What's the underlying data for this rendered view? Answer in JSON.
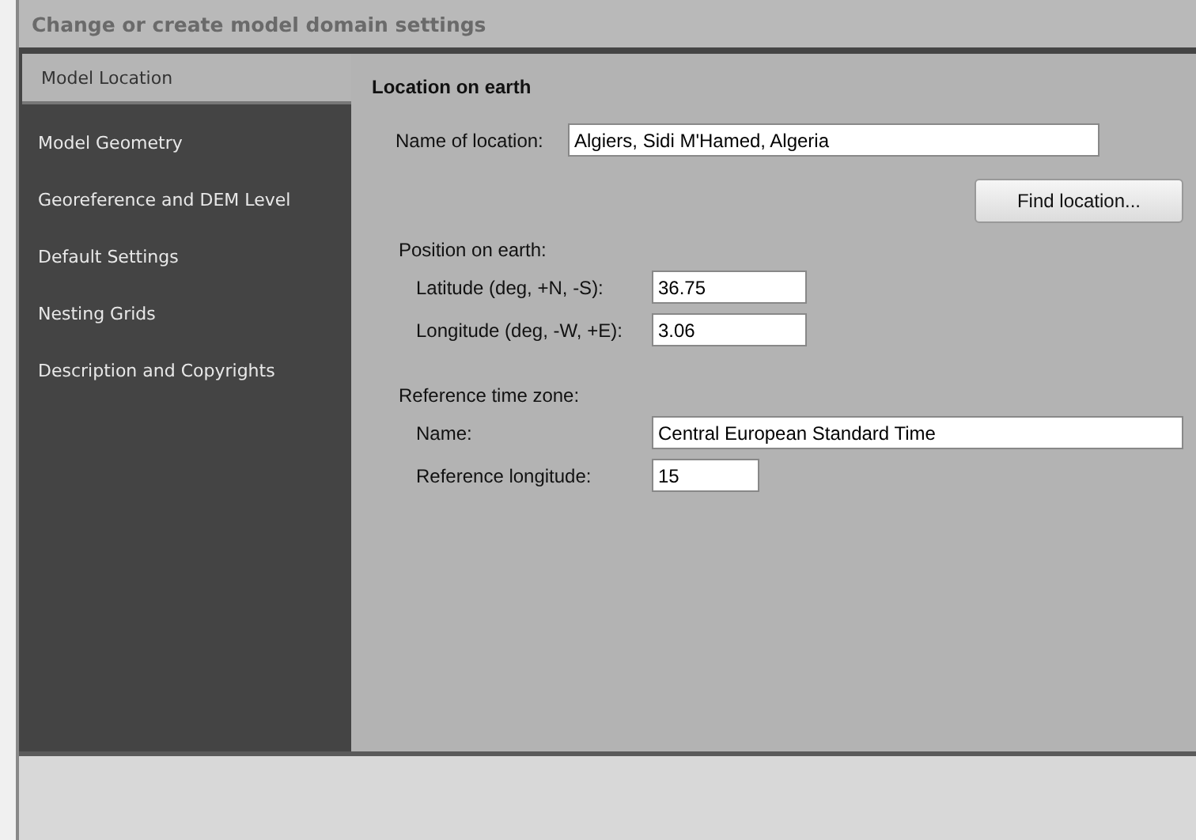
{
  "window": {
    "title": "Change or create model domain settings"
  },
  "sidebar": {
    "items": [
      {
        "label": "Model Location",
        "selected": true
      },
      {
        "label": "Model Geometry",
        "selected": false
      },
      {
        "label": "Georeference and DEM Level",
        "selected": false
      },
      {
        "label": "Default Settings",
        "selected": false
      },
      {
        "label": "Nesting Grids",
        "selected": false
      },
      {
        "label": "Description and Copyrights",
        "selected": false
      }
    ]
  },
  "content": {
    "heading": "Location on earth",
    "location_name": {
      "label": "Name of location:",
      "value": "Algiers, Sidi M'Hamed, Algeria"
    },
    "find_button": "Find location...",
    "position": {
      "label": "Position on earth:",
      "fields": [
        {
          "label": "Latitude (deg, +N, -S):",
          "value": "36.75"
        },
        {
          "label": "Longitude (deg, -W, +E):",
          "value": "3.06"
        }
      ]
    },
    "time_zone": {
      "label": "Reference time zone:",
      "fields": [
        {
          "label": "Name:",
          "value": "Central European Standard Time",
          "kind": "wide"
        },
        {
          "label": "Reference longitude:",
          "value": "15",
          "kind": "short"
        }
      ]
    }
  }
}
